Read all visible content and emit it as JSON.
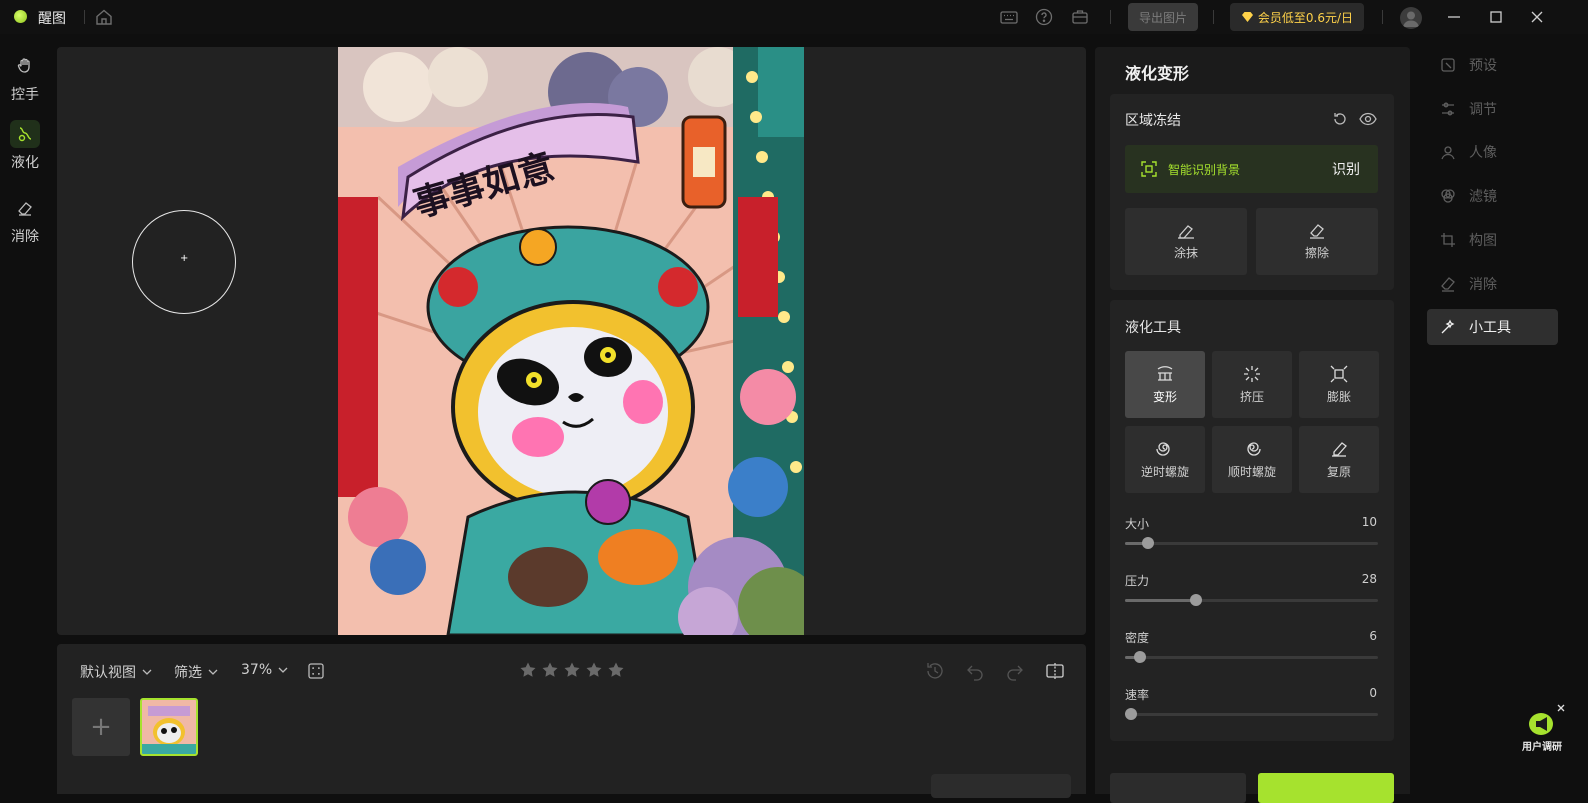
{
  "app": {
    "name": "醒图"
  },
  "titlebar": {
    "export_label": "导出图片",
    "vip_label": "会员低至0.6元/日"
  },
  "left_tools": [
    {
      "label": "控手",
      "icon": "hand-icon"
    },
    {
      "label": "液化",
      "icon": "liquify-icon",
      "active": true
    },
    {
      "label": "消除",
      "icon": "eraser-icon"
    }
  ],
  "artwork": {
    "banner_text": "事事如意"
  },
  "bottombar": {
    "view_label": "默认视图",
    "filter_label": "筛选",
    "zoom_label": "37%",
    "star_count": 5
  },
  "panel": {
    "title": "液化变形",
    "freeze": {
      "title": "区域冻结",
      "smart_label": "智能识别背景",
      "smart_action": "识别",
      "buttons": [
        "涂抹",
        "擦除"
      ]
    },
    "tools": {
      "title": "液化工具",
      "items": [
        {
          "label": "变形",
          "icon": "warp-icon",
          "active": true
        },
        {
          "label": "挤压",
          "icon": "pinch-icon"
        },
        {
          "label": "膨胀",
          "icon": "bloat-icon"
        },
        {
          "label": "逆时螺旋",
          "icon": "twirl-ccw-icon"
        },
        {
          "label": "顺时螺旋",
          "icon": "twirl-cw-icon"
        },
        {
          "label": "复原",
          "icon": "restore-icon"
        }
      ]
    },
    "sliders": [
      {
        "label": "大小",
        "value": "10",
        "fraction": 0.09
      },
      {
        "label": "压力",
        "value": "28",
        "fraction": 0.28
      },
      {
        "label": "密度",
        "value": "6",
        "fraction": 0.06
      },
      {
        "label": "速率",
        "value": "0",
        "fraction": 0.0
      }
    ]
  },
  "right_nav": [
    {
      "label": "预设",
      "icon": "preset-icon"
    },
    {
      "label": "调节",
      "icon": "adjust-icon"
    },
    {
      "label": "人像",
      "icon": "portrait-icon"
    },
    {
      "label": "滤镜",
      "icon": "filter-icon"
    },
    {
      "label": "构图",
      "icon": "crop-icon"
    },
    {
      "label": "消除",
      "icon": "erase-icon"
    },
    {
      "label": "小工具",
      "icon": "tools-icon",
      "active": true
    }
  ],
  "survey": {
    "label": "用户调研"
  },
  "colors": {
    "accent": "#a6e22e",
    "vip": "#ffd24a"
  }
}
